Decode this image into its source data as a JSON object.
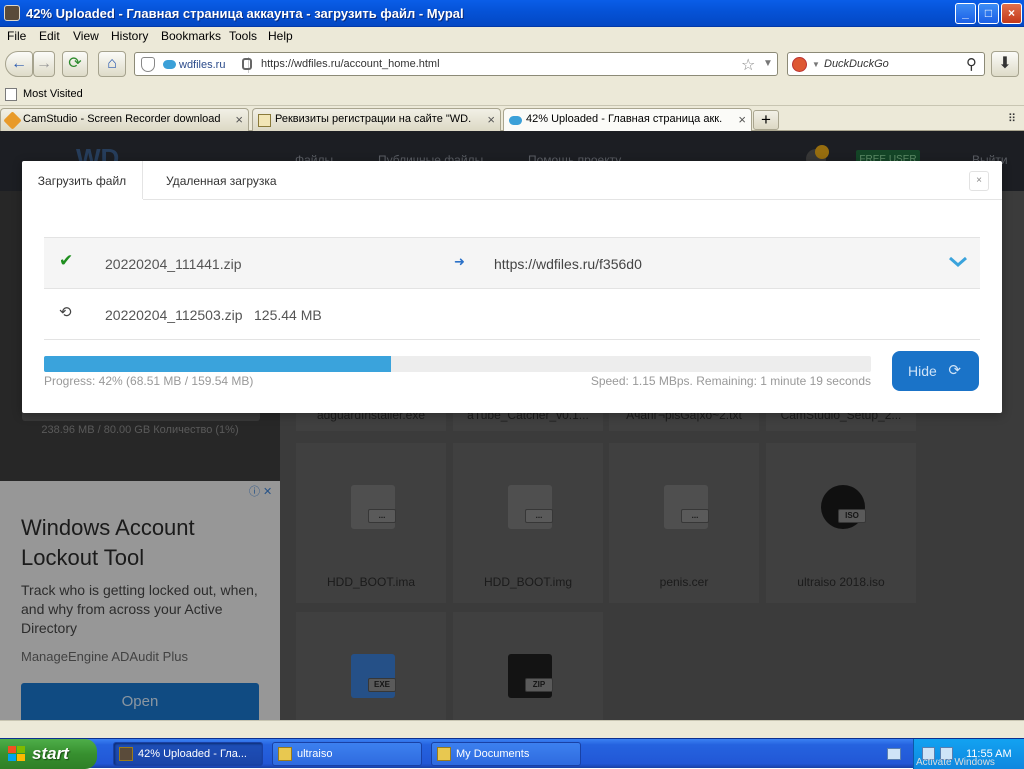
{
  "window": {
    "title": "42% Uploaded - Главная страница аккаунта - загрузить файл - Mypal",
    "min": "_",
    "max": "□",
    "close": "×"
  },
  "menu": [
    "File",
    "Edit",
    "View",
    "History",
    "Bookmarks",
    "Tools",
    "Help"
  ],
  "nav": {
    "back": "←",
    "forward": "→",
    "reload": "⟳",
    "home": "⌂",
    "site_label": "wdfiles.ru",
    "url": "https://wdfiles.ru/account_home.html",
    "search_placeholder": "DuckDuckGo"
  },
  "bookmarks": {
    "most_visited": "Most Visited"
  },
  "tabs": [
    {
      "label": "CamStudio - Screen Recorder download |..."
    },
    {
      "label": "Реквизиты регистрации на сайте \"WD..."
    },
    {
      "label": "42% Uploaded - Главная страница акк..."
    }
  ],
  "newtab": "+",
  "site": {
    "logo": "WD",
    "nav_items": [
      "Файлы",
      "Публичные файлы",
      "Помощь проекту"
    ],
    "free_badge": "FREE USER",
    "logout": "Выйти",
    "storage_text": "238.96 MB / 80.00 GB Количество (1%)"
  },
  "ad": {
    "headline": "Windows Account Lockout Tool",
    "desc": "Track who is getting locked out, when, and why from across your Active Directory",
    "brand": "ManageEngine ADAudit Plus",
    "button": "Open",
    "close": "ⓘ ✕"
  },
  "files_top": [
    "adguardInstaller.exe",
    "aTube_Catcher_v0.1...",
    "Ачапг¬рlsGa|xö~2.txt",
    "CamStudio_Setup_2..."
  ],
  "files": [
    {
      "name": "HDD_BOOT.ima",
      "badge": "..."
    },
    {
      "name": "HDD_BOOT.img",
      "badge": "..."
    },
    {
      "name": "penis.cer",
      "badge": "..."
    },
    {
      "name": "ultraiso 2018.iso",
      "badge": "ISO"
    },
    {
      "name": "",
      "badge": "EXE"
    },
    {
      "name": "",
      "badge": "ZIP"
    }
  ],
  "modal": {
    "tab_upload": "Загрузить файл",
    "tab_remote": "Удаленная загрузка",
    "close": "×",
    "row1": {
      "icon": "✔",
      "file": "20220204_111441.zip",
      "arrow": "➜",
      "link": "https://wdfiles.ru/f356d0"
    },
    "row2": {
      "icon": "⟲",
      "file": "20220204_112503.zip",
      "size": "125.44 MB"
    },
    "progress": 42,
    "progress_text": "Progress: 42% (68.51 MB / 159.54 MB)",
    "speed_text": "Speed: 1.15 MBps. Remaining: 1 minute 19 seconds",
    "hide": "Hide",
    "hide_icon": "⟳"
  },
  "taskbar": {
    "start": "start",
    "buttons": [
      "42% Uploaded - Гла...",
      "ultraiso",
      "My Documents"
    ],
    "time": "11:55 AM",
    "sub": "Activate Windows"
  }
}
